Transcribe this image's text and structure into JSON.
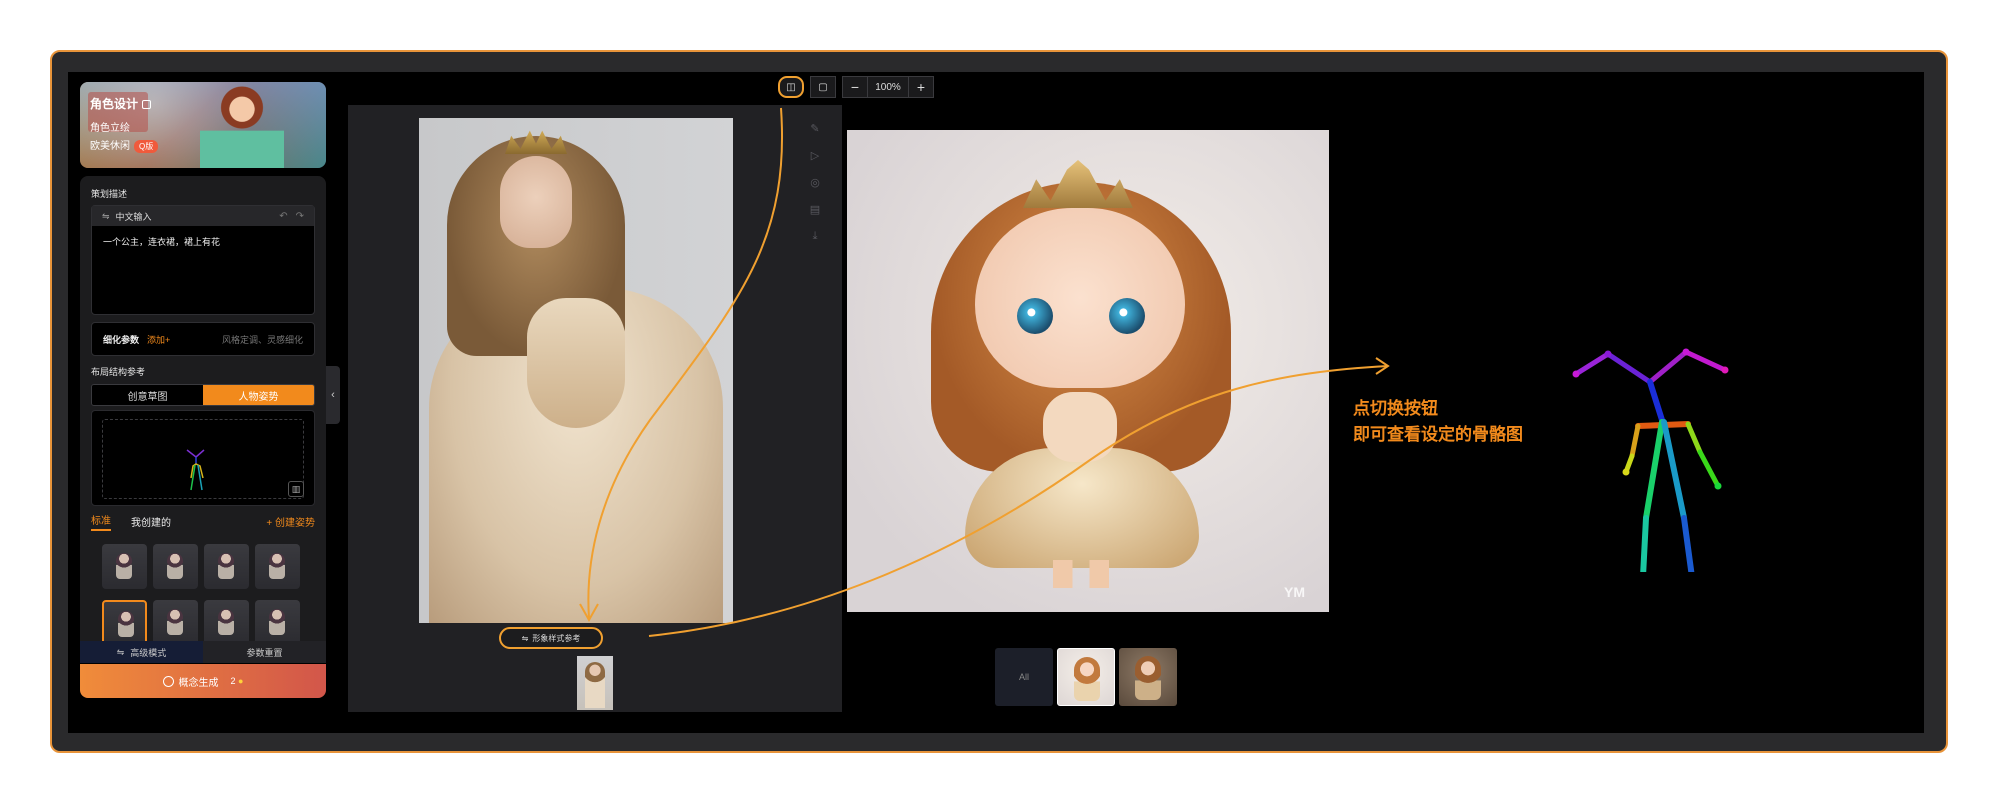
{
  "sidebar": {
    "banner": {
      "title": "角色设计",
      "line2": "角色立绘",
      "line3": "欧美休闲",
      "badge": "Q版"
    },
    "planning_label": "策划描述",
    "input_mode": "中文输入",
    "description": "一个公主，连衣裙，裙上有花",
    "refine_label": "细化参数",
    "refine_add": "添加+",
    "refine_hint": "风格定调、灵感细化",
    "layout_label": "布局结构参考",
    "seg_tabs": [
      "创意草图",
      "人物姿势"
    ],
    "pose_tabs": {
      "standard": "标准",
      "mine": "我创建的",
      "create": "+ 创建姿势"
    },
    "bottom_tabs": [
      "高级模式",
      "参数重置"
    ],
    "generate": {
      "label": "概念生成",
      "count": "2"
    }
  },
  "toolbar": {
    "zoom": "100%"
  },
  "canvas": {
    "ref_label": "形象样式参考"
  },
  "results": {
    "all_label": "All"
  },
  "callout": {
    "line1": "点切换按钮",
    "line2": "即可查看设定的骨骼图"
  },
  "result_watermark": "YM",
  "colors": {
    "accent": "#f28a1c",
    "highlight": "#f0a030"
  },
  "icons": [
    "edit-icon",
    "swap-icon",
    "undo-icon",
    "redo-icon",
    "delete-icon",
    "collapse-chevron-icon",
    "magic-icon",
    "send-icon",
    "download-icon",
    "palette-icon",
    "compare-icon",
    "single-view-icon"
  ]
}
